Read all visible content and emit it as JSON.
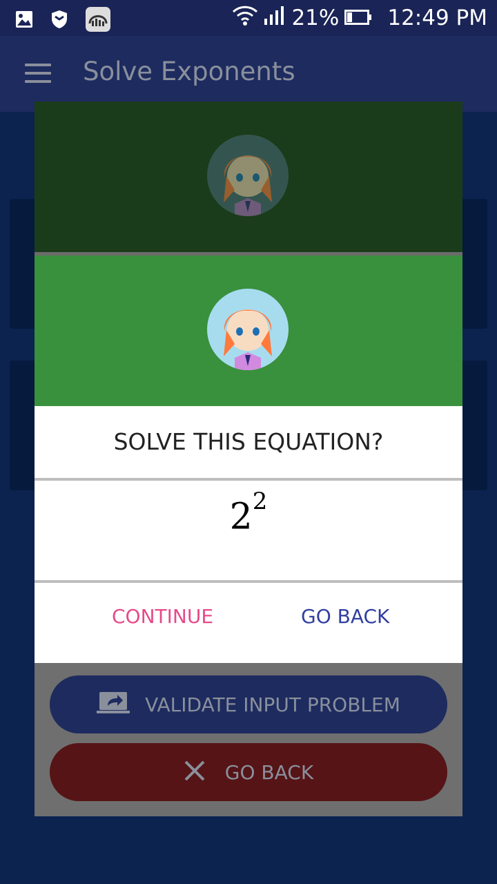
{
  "status_bar": {
    "signal_percent": "21%",
    "time": "12:49 PM",
    "icons": [
      "image-icon",
      "shield-icon",
      "podcast-app-icon",
      "wifi-icon",
      "signal-icon",
      "battery-icon"
    ]
  },
  "app_bar": {
    "title": "Solve Exponents",
    "menu_icon": "hamburger-menu-icon"
  },
  "dialog": {
    "header_colors": {
      "dim": "#1b3c1b",
      "bright": "#39903d"
    },
    "question": "SOLVE THIS EQUATION?",
    "equation": {
      "base": "2",
      "exponent": "2"
    },
    "continue_label": "CONTINUE",
    "go_back_label": "GO BACK",
    "continue_color": "#e64a8a",
    "go_back_color": "#303f9f"
  },
  "buttons": {
    "validate_label": "VALIDATE INPUT PROBLEM",
    "validate_icon": "share-screen-icon",
    "back_label": "GO BACK",
    "back_icon": "close-icon"
  }
}
